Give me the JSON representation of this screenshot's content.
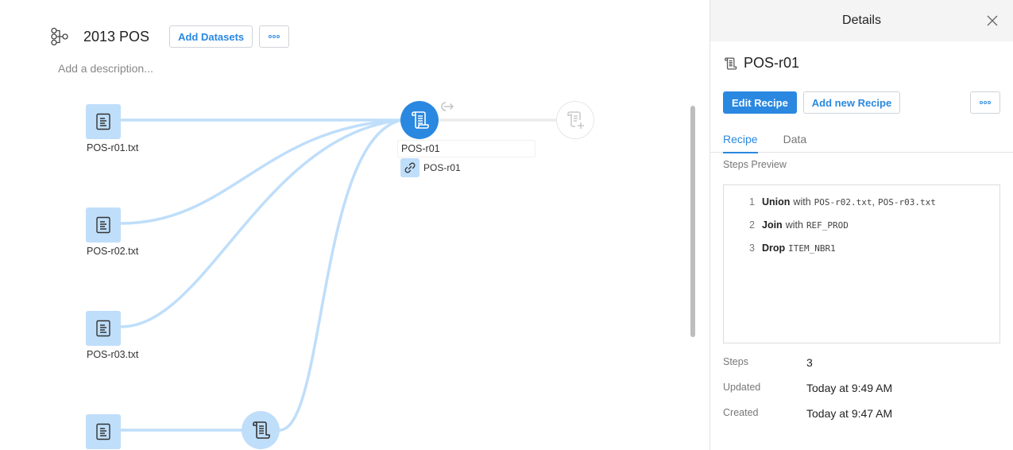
{
  "flow": {
    "title": "2013 POS",
    "description_placeholder": "Add a description...",
    "add_datasets_label": "Add Datasets",
    "more_label": "more-options"
  },
  "nodes": {
    "datasets": [
      {
        "name": "POS-r01.txt"
      },
      {
        "name": "POS-r02.txt"
      },
      {
        "name": "POS-r03.txt"
      },
      {
        "name": ""
      }
    ],
    "recipe": {
      "name": "POS-r01",
      "linked_output": "POS-r01"
    }
  },
  "colors": {
    "accent": "#2a88e0",
    "node_light": "#bfdefa",
    "edge": "#bfdefa",
    "panel_header_bg": "#f4f4f4"
  },
  "details": {
    "title": "Details",
    "name": "POS-r01",
    "edit_recipe_label": "Edit Recipe",
    "add_new_recipe_label": "Add new Recipe",
    "tabs": [
      {
        "label": "Recipe",
        "active": true
      },
      {
        "label": "Data",
        "active": false
      }
    ],
    "steps_preview_label": "Steps Preview",
    "steps": [
      {
        "num": "1",
        "op": "Union",
        "text": "with",
        "args": "POS-r02.txt",
        "sep": ",",
        "args2": "POS-r03.txt"
      },
      {
        "num": "2",
        "op": "Join",
        "text": "with",
        "args": "REF_PROD"
      },
      {
        "num": "3",
        "op": "Drop",
        "text": "",
        "args": "ITEM_NBR1"
      }
    ],
    "meta": [
      {
        "label": "Steps",
        "value": "3"
      },
      {
        "label": "Updated",
        "value": "Today at 9:49 AM"
      },
      {
        "label": "Created",
        "value": "Today at 9:47 AM"
      }
    ]
  }
}
